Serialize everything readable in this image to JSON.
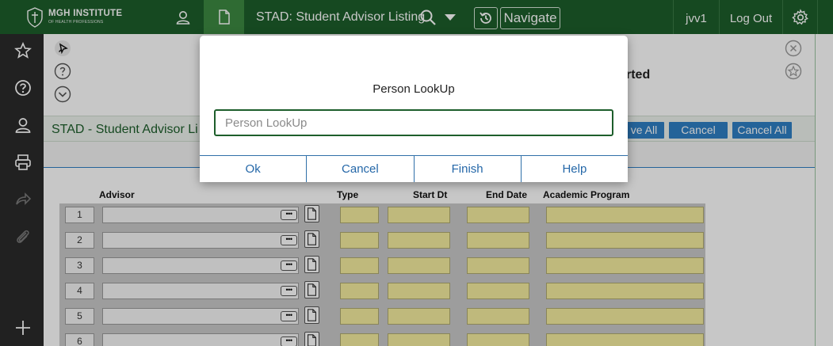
{
  "topbar": {
    "logo_line1": "MGH INSTITUTE",
    "logo_line2": "OF HEALTH PROFESSIONS",
    "title": "STAD: Student Advisor Listing",
    "navigate_label": "Navigate",
    "user_id": "jvv1",
    "logout_label": "Log Out",
    "bar_color": "#1d5e2b",
    "active_color": "#3d8a42"
  },
  "sidebar": {
    "icons": [
      "star-icon",
      "help-icon",
      "user-icon",
      "print-icon",
      "share-icon",
      "paperclip-icon",
      "plus-icon"
    ]
  },
  "content": {
    "partial_title": "rted",
    "form_title": "STAD - Student Advisor Li",
    "header_buttons": {
      "save_all": "ve All",
      "cancel": "Cancel",
      "cancel_all": "Cancel All"
    }
  },
  "grid": {
    "columns": {
      "advisor": "Advisor",
      "type": "Type",
      "start_dt": "Start Dt",
      "end_date": "End Date",
      "academic_program": "Academic Program"
    },
    "rows": [
      "1",
      "2",
      "3",
      "4",
      "5",
      "6"
    ],
    "required_color": "#f5ee9f"
  },
  "modal": {
    "title": "Person LookUp",
    "input_placeholder": "Person LookUp",
    "input_value": "",
    "buttons": {
      "ok": "Ok",
      "cancel": "Cancel",
      "finish": "Finish",
      "help": "Help"
    }
  }
}
